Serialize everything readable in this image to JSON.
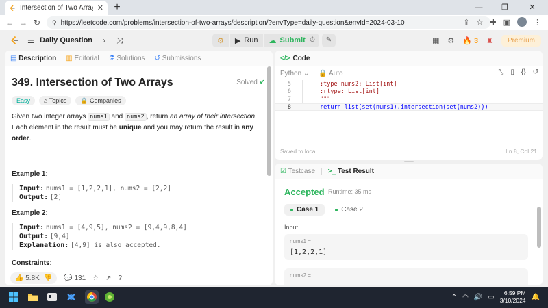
{
  "browser": {
    "tab_title": "Intersection of Two Arrays - Leet",
    "url": "https://leetcode.com/problems/intersection-of-two-arrays/description/?envType=daily-question&envId=2024-03-10"
  },
  "header": {
    "nav_label": "Daily Question",
    "run_label": "Run",
    "submit_label": "Submit",
    "streak_count": "3",
    "premium_label": "Premium"
  },
  "left_tabs": [
    "Description",
    "Editorial",
    "Solutions",
    "Submissions"
  ],
  "problem": {
    "title": "349. Intersection of Two Arrays",
    "status": "Solved",
    "tags": [
      "Easy",
      "Topics",
      "Companies"
    ],
    "text_1": "Given two integer arrays ",
    "code_1": "nums1",
    "text_2": " and ",
    "code_2": "nums2",
    "text_3": ", return ",
    "text_em": "an array of their intersection",
    "text_4": ". Each element in the result must be ",
    "text_b1": "unique",
    "text_5": " and you may return the result in ",
    "text_b2": "any order",
    "text_6": ".",
    "examples": [
      {
        "heading": "Example 1:",
        "input_label": "Input:",
        "input_value": "nums1 = [1,2,2,1], nums2 = [2,2]",
        "output_label": "Output:",
        "output_value": "[2]"
      },
      {
        "heading": "Example 2:",
        "input_label": "Input:",
        "input_value": "nums1 = [4,9,5], nums2 = [9,4,9,8,4]",
        "output_label": "Output:",
        "output_value": "[9,4]",
        "explanation_label": "Explanation:",
        "explanation_value": "[4,9] is also accepted."
      }
    ],
    "constraints_heading": "Constraints:",
    "likes": "5.8K",
    "comments": "131"
  },
  "code_panel": {
    "title": "Code",
    "language": "Python",
    "mode": "Auto",
    "lines": [
      {
        "no": "5",
        "text": ":type nums2: List[int]"
      },
      {
        "no": "6",
        "text": ":rtype: List[int]"
      },
      {
        "no": "7",
        "text": "\"\"\""
      },
      {
        "no": "8",
        "text": "return list(set(nums1).intersection(set(nums2)))"
      }
    ],
    "saved_status": "Saved to local",
    "cursor_pos": "Ln 8, Col 21"
  },
  "result_panel": {
    "tab_testcase": "Testcase",
    "tab_result": "Test Result",
    "verdict": "Accepted",
    "runtime": "Runtime: 35 ms",
    "cases": [
      "Case 1",
      "Case 2"
    ],
    "input_label": "Input",
    "params": [
      {
        "name": "nums1 =",
        "value": "[1,2,2,1]"
      },
      {
        "name": "nums2 =",
        "value": ""
      }
    ]
  },
  "taskbar": {
    "time": "6:59 PM",
    "date": "3/10/2024"
  },
  "colors": {
    "accent_green": "#2db55d",
    "streak_orange": "#ffa116",
    "premium": "#e8a14e",
    "easy": "#00af9b"
  }
}
